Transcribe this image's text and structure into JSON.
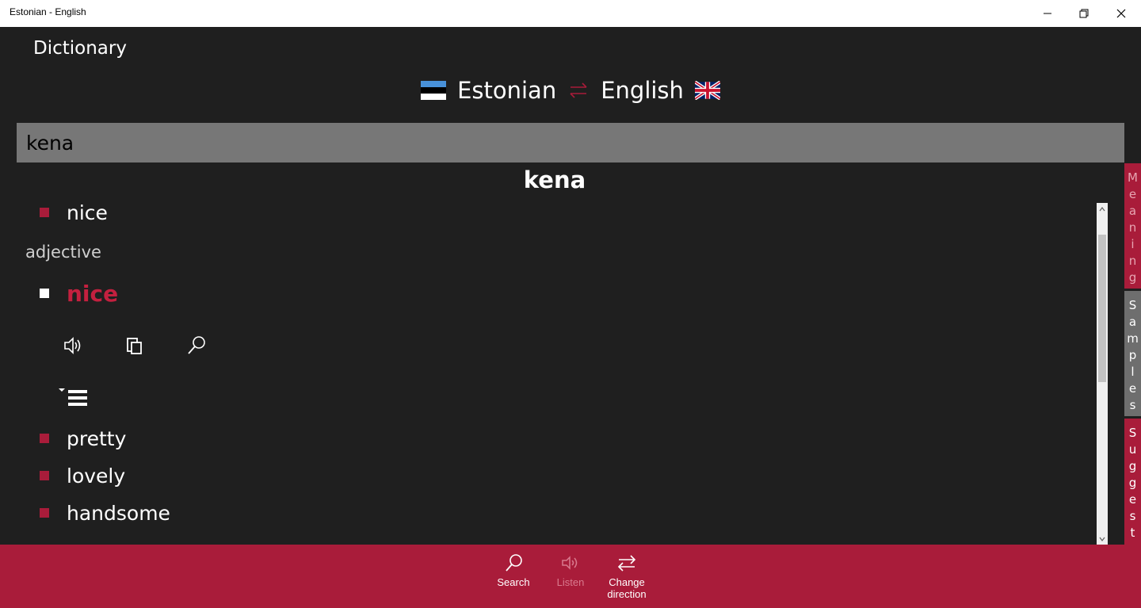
{
  "window": {
    "title": "Estonian - English"
  },
  "app": {
    "title": "Dictionary"
  },
  "languages": {
    "source": "Estonian",
    "target": "English"
  },
  "search": {
    "value": "kena"
  },
  "result": {
    "headword": "kena",
    "primary_translation": "nice",
    "part_of_speech": "adjective",
    "selected_translation": "nice",
    "translations": [
      "pretty",
      "lovely",
      "handsome"
    ]
  },
  "side_tabs": [
    {
      "label": "Meaning",
      "letters": [
        "M",
        "e",
        "a",
        "n",
        "i",
        "n",
        "g"
      ],
      "color": "#a91c3a"
    },
    {
      "label": "Samples",
      "letters": [
        "S",
        "a",
        "m",
        "p",
        "l",
        "e",
        "s"
      ],
      "color": "#6e6e6e"
    },
    {
      "label": "Suggest",
      "letters": [
        "S",
        "u",
        "g",
        "g",
        "e",
        "s",
        "t"
      ],
      "color": "#a91c3a"
    }
  ],
  "bottom_bar": {
    "search_label": "Search",
    "listen_label": "Listen",
    "change_direction_label_1": "Change",
    "change_direction_label_2": "direction"
  },
  "colors": {
    "accent": "#a91c3a",
    "background": "#1f1f1f",
    "search_bg": "#777777"
  },
  "icons": {
    "speaker": "speaker-icon",
    "copy": "copy-icon",
    "search": "search-icon",
    "list": "list-icon",
    "swap": "swap-arrows-icon"
  }
}
